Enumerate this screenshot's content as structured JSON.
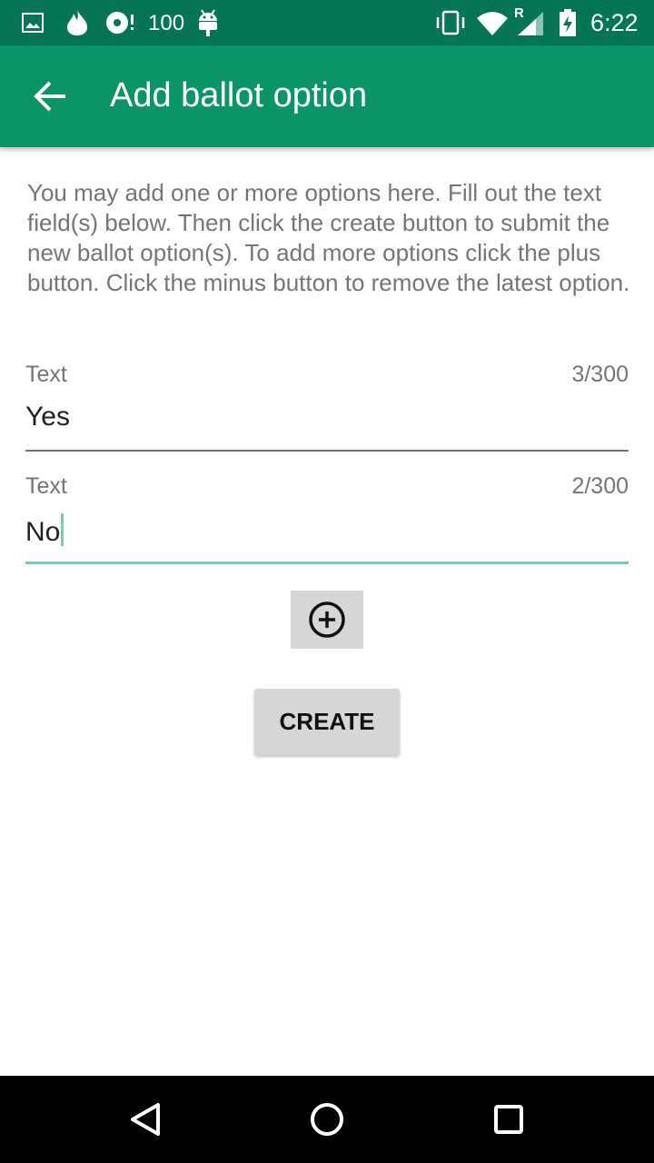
{
  "status_bar": {
    "icons_left": [
      "image-icon",
      "fire-icon",
      "disc-icon",
      "android-icon"
    ],
    "battery_count": "100",
    "icons_right": [
      "vibrate-icon",
      "wifi-icon",
      "signal-icon",
      "battery-charging-icon"
    ],
    "roaming": "R",
    "time": "6:22"
  },
  "app_bar": {
    "title": "Add ballot option",
    "back_icon": "arrow-back-icon"
  },
  "description": "You may add one or more options here. Fill out the text field(s) below. Then click the create button to submit the new ballot option(s). To add more options click the plus button. Click the minus button to remove the latest option.",
  "fields": [
    {
      "label": "Text",
      "value": "Yes",
      "counter": "3/300"
    },
    {
      "label": "Text",
      "value": "No",
      "counter": "2/300"
    }
  ],
  "add_button_icon": "add-circle-icon",
  "create_label": "CREATE",
  "nav_bar": [
    "back-triangle-icon",
    "home-circle-icon",
    "recents-square-icon"
  ],
  "colors": {
    "status_bar": "#057553",
    "app_bar": "#0a9468",
    "accent": "#7fc9b1"
  }
}
